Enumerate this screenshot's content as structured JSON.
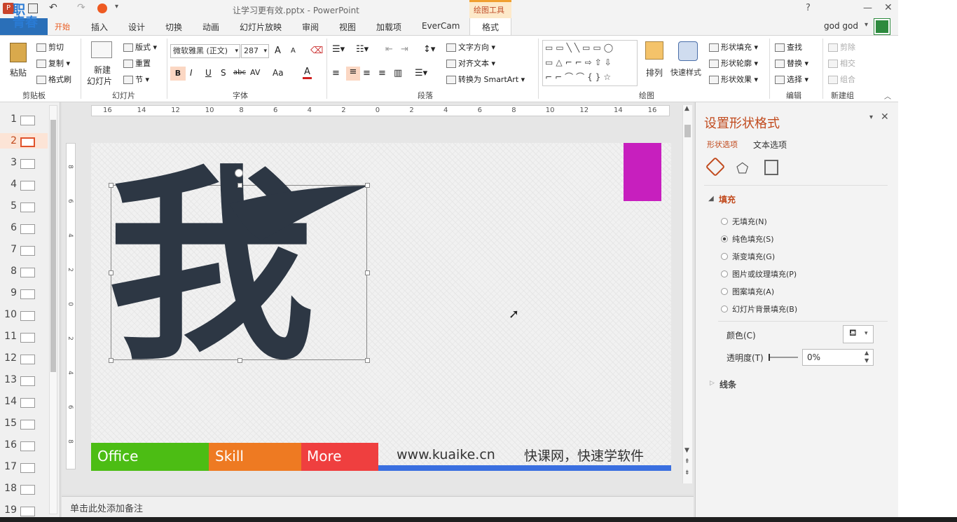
{
  "window": {
    "title": "让学习更有效.pptx - PowerPoint",
    "user": "god god",
    "help": "?"
  },
  "qat": {
    "badge": "职\n青春",
    "start": "开始"
  },
  "tabs": [
    "插入",
    "设计",
    "切换",
    "动画",
    "幻灯片放映",
    "审阅",
    "视图",
    "加载项",
    "EverCam"
  ],
  "context_tab": {
    "group": "绘图工具",
    "label": "格式"
  },
  "ribbon": {
    "clipboard": {
      "paste": "粘贴",
      "cut": "剪切",
      "copy": "复制",
      "format_painter": "格式刷",
      "label": "剪贴板"
    },
    "slides": {
      "new_slide_1": "新建",
      "new_slide_2": "幻灯片",
      "layout": "版式",
      "reset": "重置",
      "section": "节",
      "label": "幻灯片"
    },
    "font": {
      "name": "微软雅黑 (正文)",
      "size": "287",
      "bold": "B",
      "italic": "I",
      "underline": "U",
      "shadow": "S",
      "strike": "abc",
      "spacing": "AV",
      "case": "Aa",
      "color": "A",
      "grow": "A",
      "shrink": "A",
      "label": "字体"
    },
    "paragraph": {
      "text_direction": "文字方向",
      "align_text": "对齐文本",
      "smartart": "转换为 SmartArt",
      "label": "段落"
    },
    "drawing": {
      "arrange": "排列",
      "quick_styles": "快速样式",
      "fill": "形状填充",
      "outline": "形状轮廓",
      "effects": "形状效果",
      "label": "绘图"
    },
    "editing": {
      "find": "查找",
      "replace": "替换",
      "select": "选择",
      "label": "编辑"
    },
    "newgroup": {
      "delete": "剪除",
      "intersect": "相交",
      "union": "组合",
      "label": "新建组"
    }
  },
  "slide_panel": {
    "numbers": [
      "1",
      "2",
      "3",
      "4",
      "5",
      "6",
      "7",
      "8",
      "9",
      "10",
      "11",
      "12",
      "13",
      "14",
      "15",
      "16",
      "17",
      "18",
      "19"
    ]
  },
  "ruler": {
    "h_ticks": [
      "16",
      "14",
      "12",
      "10",
      "8",
      "6",
      "4",
      "2",
      "0",
      "2",
      "4",
      "6",
      "8",
      "10",
      "12",
      "14",
      "16"
    ],
    "v_ticks": [
      "8",
      "6",
      "4",
      "2",
      "0",
      "2",
      "4",
      "6",
      "8"
    ]
  },
  "slide": {
    "big_char": "我",
    "footer": {
      "office": "Office",
      "skill": "Skill",
      "more": "More",
      "url": "www.kuaike.cn",
      "slogan": "快课网，快速学软件"
    },
    "colors": {
      "office": "#4cbd14",
      "skill": "#ee7a22",
      "more": "#ef3f3f",
      "line": "#3a6fe0",
      "magenta": "#c71fbe",
      "char": "#2d3744"
    }
  },
  "notes": {
    "placeholder": "单击此处添加备注"
  },
  "format_pane": {
    "title": "设置形状格式",
    "tab_shape": "形状选项",
    "tab_text": "文本选项",
    "fill_section": "填充",
    "options": [
      "无填充(N)",
      "纯色填充(S)",
      "渐变填充(G)",
      "图片或纹理填充(P)",
      "图案填充(A)",
      "幻灯片背景填充(B)"
    ],
    "selected_option": 1,
    "color_label": "颜色(C)",
    "transparency_label": "透明度(T)",
    "transparency_value": "0%",
    "line_section": "线条"
  }
}
